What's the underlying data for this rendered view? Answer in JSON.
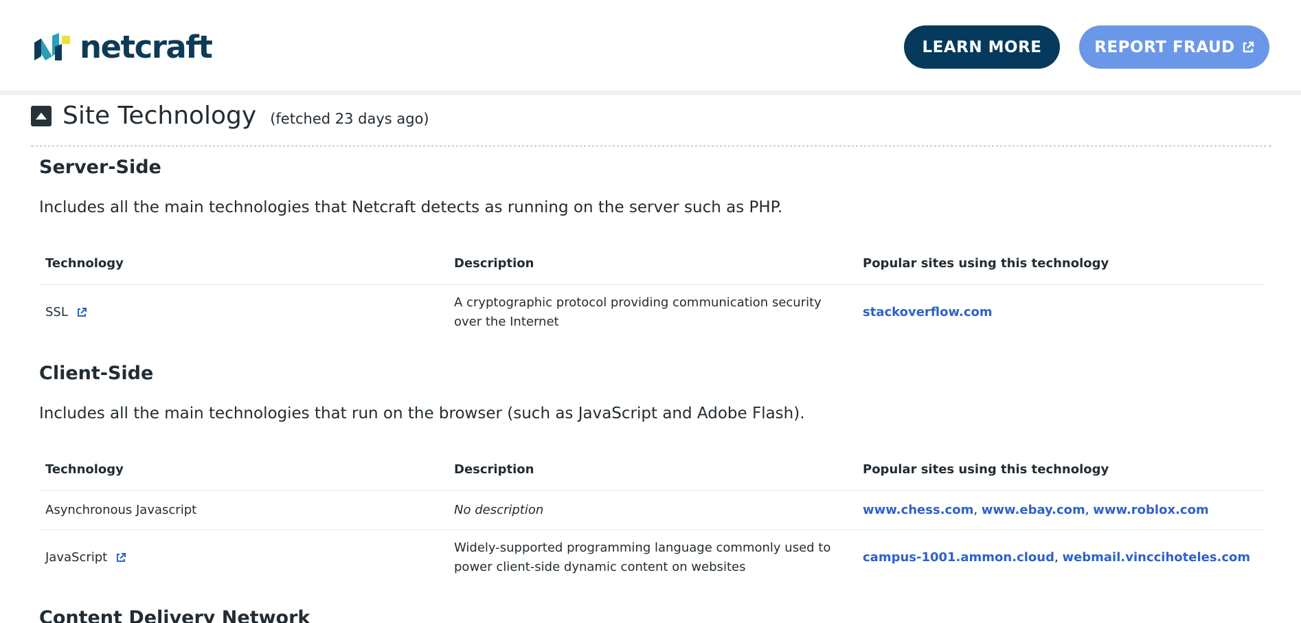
{
  "header": {
    "logo_text": "netcraft",
    "learn_more_label": "LEARN MORE",
    "report_fraud_label": "REPORT FRAUD",
    "colors": {
      "brand_dark": "#053a5c",
      "brand_light": "#6a97e8",
      "logo_yellow": "#e8e23a",
      "logo_teal": "#2aa0b8"
    }
  },
  "section": {
    "title": "Site Technology",
    "fetched": "(fetched 23 days ago)",
    "toggle_icon": "caret-up-icon"
  },
  "server_side": {
    "title": "Server-Side",
    "description": "Includes all the main technologies that Netcraft detects as running on the server such as PHP.",
    "columns": [
      "Technology",
      "Description",
      "Popular sites using this technology"
    ],
    "rows": [
      {
        "technology": "SSL",
        "has_link_icon": true,
        "description": "A cryptographic protocol providing communication security over the Internet",
        "sites": [
          "stackoverflow.com"
        ]
      }
    ]
  },
  "client_side": {
    "title": "Client-Side",
    "description": "Includes all the main technologies that run on the browser (such as JavaScript and Adobe Flash).",
    "columns": [
      "Technology",
      "Description",
      "Popular sites using this technology"
    ],
    "rows": [
      {
        "technology": "Asynchronous Javascript",
        "has_link_icon": false,
        "description": "No description",
        "sites": [
          "www.chess.com",
          "www.ebay.com",
          "www.roblox.com"
        ]
      },
      {
        "technology": "JavaScript",
        "has_link_icon": true,
        "description": "Widely-supported programming language commonly used to power client-side dynamic content on websites",
        "sites": [
          "campus-1001.ammon.cloud",
          "webmail.vinccihoteles.com"
        ]
      }
    ]
  },
  "cdn": {
    "title": "Content Delivery Network"
  }
}
